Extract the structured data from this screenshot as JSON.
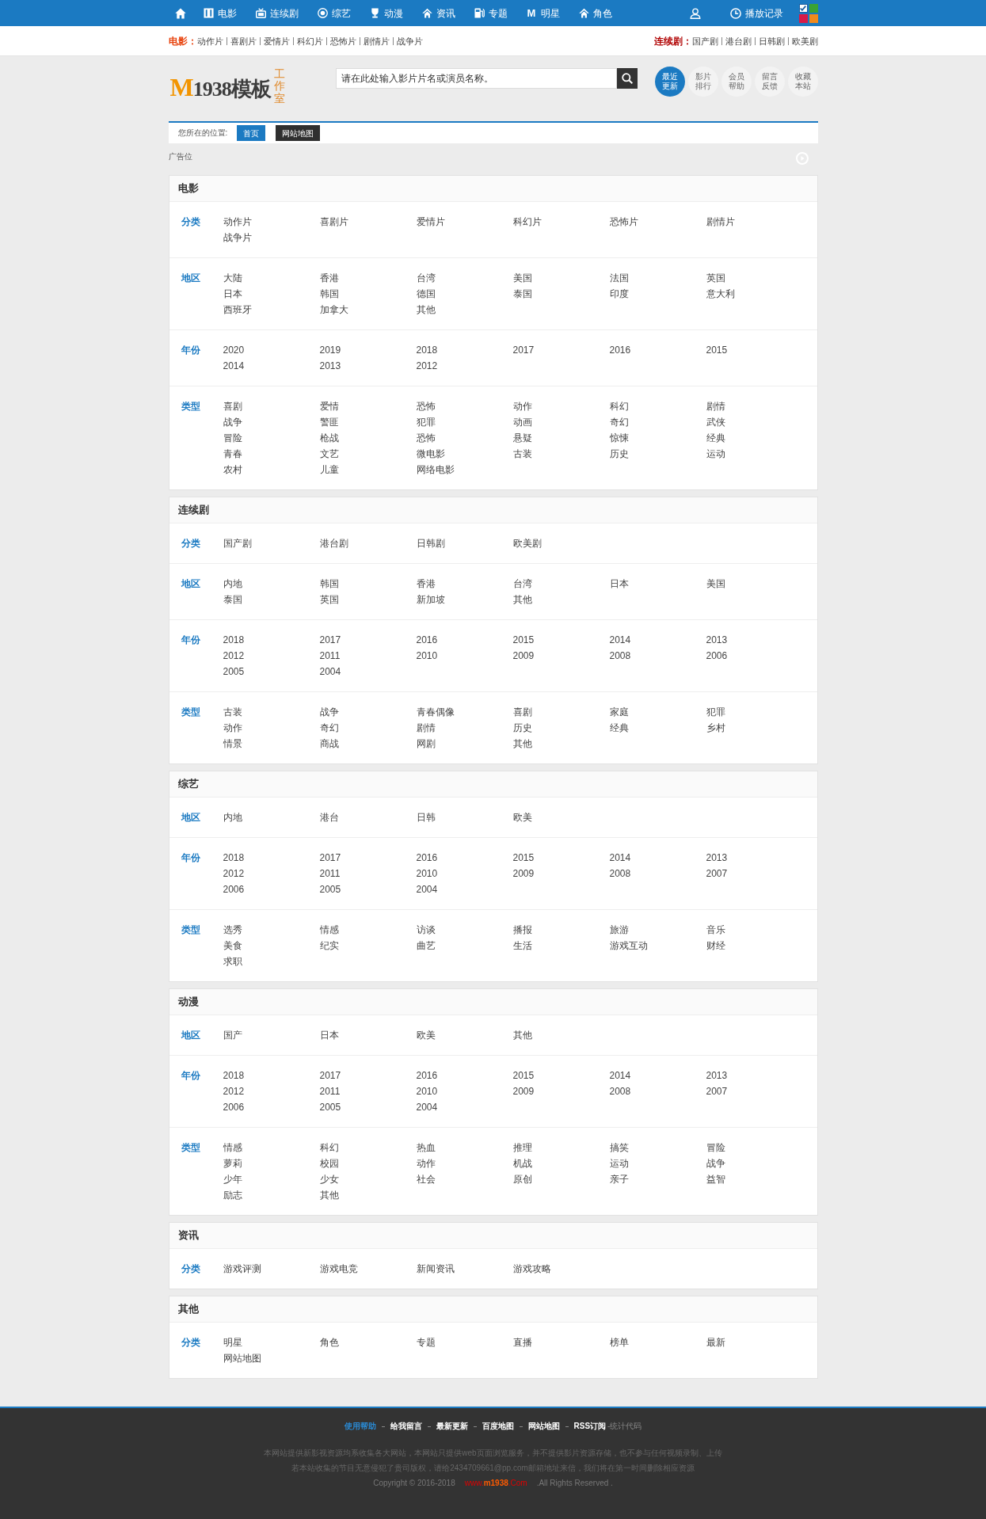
{
  "top_nav": {
    "links": [
      {
        "label": "电影"
      },
      {
        "label": "连续剧"
      },
      {
        "label": "综艺"
      },
      {
        "label": "动漫"
      },
      {
        "label": "资讯"
      },
      {
        "label": "专题"
      },
      {
        "glyph": "M",
        "label": "明星"
      },
      {
        "label": "角色"
      }
    ],
    "history": {
      "label": "播放记录"
    },
    "themes": [
      {
        "color": "#1d5fa0",
        "selected": true
      },
      {
        "color": "#3aa335",
        "selected": false
      },
      {
        "color": "#d81b48",
        "selected": false
      },
      {
        "color": "#f08a1c",
        "selected": false
      }
    ]
  },
  "sub_nav": [
    {
      "label": "电影：",
      "links": [
        "动作片",
        "喜剧片",
        "爱情片",
        "科幻片",
        "恐怖片",
        "剧情片",
        "战争片"
      ]
    },
    {
      "label": "连续剧：",
      "links": [
        "国产剧",
        "港台剧",
        "日韩剧",
        "欧美剧"
      ]
    }
  ],
  "header": {
    "logo": {
      "initial": "M",
      "name": "1938模板",
      "tagline": "工作室"
    },
    "search": {
      "placeholder": "请在此处输入影片片名或演员名称。"
    },
    "quick_links": [
      {
        "label": "最近更新",
        "selected": true
      },
      {
        "label": "影片排行",
        "selected": false
      },
      {
        "label": "会员帮助",
        "selected": false
      },
      {
        "label": "留言反馈",
        "selected": false
      },
      {
        "label": "收藏本站",
        "selected": false
      }
    ]
  },
  "breadcrumb": {
    "label": "您所在的位置:",
    "links": [
      {
        "label": "首页",
        "selected": true
      },
      {
        "label": "网站地图",
        "selected": false
      }
    ]
  },
  "ad": {
    "label": "广告位"
  },
  "sections": [
    {
      "title": "电影",
      "rows": [
        {
          "label": "分类",
          "items": [
            "动作片",
            "喜剧片",
            "爱情片",
            "科幻片",
            "恐怖片",
            "剧情片",
            "战争片"
          ]
        },
        {
          "label": "地区",
          "items": [
            "大陆",
            "香港",
            "台湾",
            "美国",
            "法国",
            "英国",
            "日本",
            "韩国",
            "德国",
            "泰国",
            "印度",
            "意大利",
            "西班牙",
            "加拿大",
            "其他"
          ]
        },
        {
          "label": "年份",
          "items": [
            "2020",
            "2019",
            "2018",
            "2017",
            "2016",
            "2015",
            "2014",
            "2013",
            "2012"
          ]
        },
        {
          "label": "类型",
          "items": [
            "喜剧",
            "爱情",
            "恐怖",
            "动作",
            "科幻",
            "剧情",
            "战争",
            "警匪",
            "犯罪",
            "动画",
            "奇幻",
            "武侠",
            "冒险",
            "枪战",
            "恐怖",
            "悬疑",
            "惊悚",
            "经典",
            "青春",
            "文艺",
            "微电影",
            "古装",
            "历史",
            "运动",
            "农村",
            "儿童",
            "网络电影"
          ]
        }
      ]
    },
    {
      "title": "连续剧",
      "rows": [
        {
          "label": "分类",
          "items": [
            "国产剧",
            "港台剧",
            "日韩剧",
            "欧美剧"
          ]
        },
        {
          "label": "地区",
          "items": [
            "内地",
            "韩国",
            "香港",
            "台湾",
            "日本",
            "美国",
            "泰国",
            "英国",
            "新加坡",
            "其他"
          ]
        },
        {
          "label": "年份",
          "items": [
            "2018",
            "2017",
            "2016",
            "2015",
            "2014",
            "2013",
            "2012",
            "2011",
            "2010",
            "2009",
            "2008",
            "2006",
            "2005",
            "2004"
          ]
        },
        {
          "label": "类型",
          "items": [
            "古装",
            "战争",
            "青春偶像",
            "喜剧",
            "家庭",
            "犯罪",
            "动作",
            "奇幻",
            "剧情",
            "历史",
            "经典",
            "乡村",
            "情景",
            "商战",
            "网剧",
            "其他"
          ]
        }
      ]
    },
    {
      "title": "综艺",
      "rows": [
        {
          "label": "地区",
          "items": [
            "内地",
            "港台",
            "日韩",
            "欧美"
          ]
        },
        {
          "label": "年份",
          "items": [
            "2018",
            "2017",
            "2016",
            "2015",
            "2014",
            "2013",
            "2012",
            "2011",
            "2010",
            "2009",
            "2008",
            "2007",
            "2006",
            "2005",
            "2004"
          ]
        },
        {
          "label": "类型",
          "items": [
            "选秀",
            "情感",
            "访谈",
            "播报",
            "旅游",
            "音乐",
            "美食",
            "纪实",
            "曲艺",
            "生活",
            "游戏互动",
            "财经",
            "求职"
          ]
        }
      ]
    },
    {
      "title": "动漫",
      "rows": [
        {
          "label": "地区",
          "items": [
            "国产",
            "日本",
            "欧美",
            "其他"
          ]
        },
        {
          "label": "年份",
          "items": [
            "2018",
            "2017",
            "2016",
            "2015",
            "2014",
            "2013",
            "2012",
            "2011",
            "2010",
            "2009",
            "2008",
            "2007",
            "2006",
            "2005",
            "2004"
          ]
        },
        {
          "label": "类型",
          "items": [
            "情感",
            "科幻",
            "热血",
            "推理",
            "搞笑",
            "冒险",
            "萝莉",
            "校园",
            "动作",
            "机战",
            "运动",
            "战争",
            "少年",
            "少女",
            "社会",
            "原创",
            "亲子",
            "益智",
            "励志",
            "其他"
          ]
        }
      ]
    },
    {
      "title": "资讯",
      "rows": [
        {
          "label": "分类",
          "items": [
            "游戏评测",
            "游戏电竞",
            "新闻资讯",
            "游戏攻略"
          ]
        }
      ]
    },
    {
      "title": "其他",
      "rows": [
        {
          "label": "分类",
          "items": [
            "明星",
            "角色",
            "专题",
            "直播",
            "榜单",
            "最新",
            "网站地图"
          ]
        }
      ]
    }
  ],
  "footer": {
    "links": [
      {
        "label": "使用帮助",
        "selected": true
      },
      {
        "label": "给我留言",
        "selected": false
      },
      {
        "label": "最新更新",
        "selected": false
      },
      {
        "label": "百度地图",
        "selected": false
      },
      {
        "label": "网站地图",
        "selected": false
      },
      {
        "label": "RSS订阅",
        "selected": false
      }
    ],
    "stats": "-统计代码",
    "notice": [
      "本网站提供新影视资源均系收集各大网站，本网站只提供web页面浏览服务，并不提供影片资源存储，也不参与任何视频录制、上传",
      "若本站收集的节目无意侵犯了贵司版权，请给2434709661@pp.com邮箱地址来信，我们将在第一时间删除相应资源"
    ],
    "copyright": {
      "text": "Copyright © 2016-2018",
      "site": "www.**m1938**.Com",
      "rights": ".All Rights Reserved ."
    }
  }
}
